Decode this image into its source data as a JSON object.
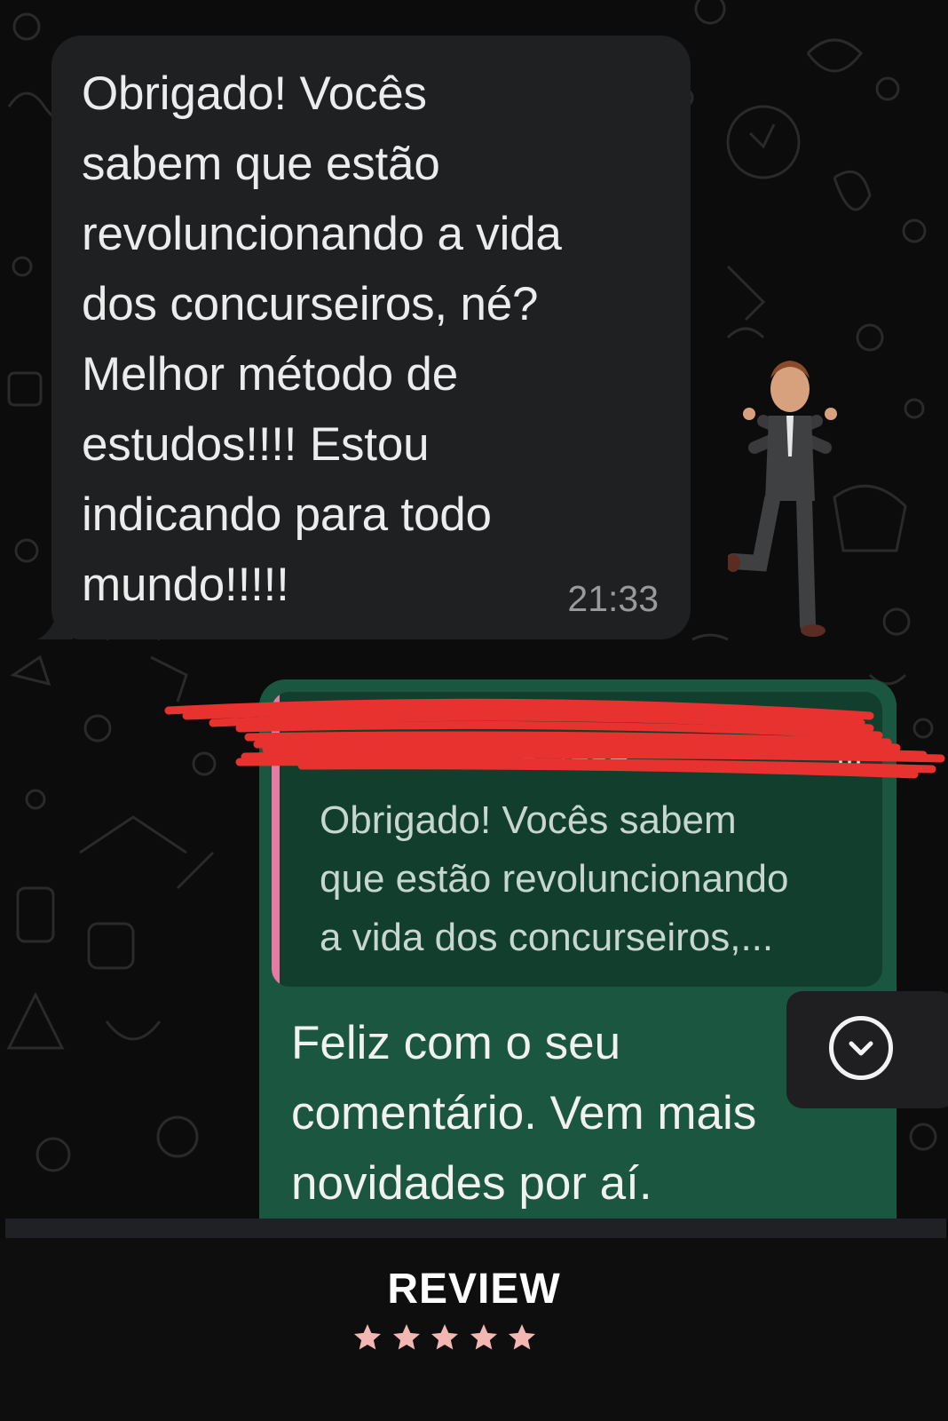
{
  "incoming_message": {
    "text": "Obrigado! Vocês\nsabem que estão\nrevoluncionando a vida\ndos concurseiros, né?\nMelhor método de\nestudos!!!! Estou\nindicando para todo\nmundo!!!!!",
    "time": "21:33"
  },
  "sticker": {
    "icon": "dancing-avatar-sticker-icon"
  },
  "outgoing_message": {
    "quote": {
      "text": "Obrigado! Vocês sabem\nque estão revoluncionando\na vida dos concurseiros,...",
      "more": "...",
      "bar_color": "#e57aa4"
    },
    "text": "Feliz com o seu\ncomentário. Vem mais\nnovidades por aí."
  },
  "scroll_button": {
    "icon": "chevron-down-icon"
  },
  "footer": {
    "title": "REVIEW",
    "rating": 5,
    "star_color": "#f2b7b3"
  },
  "colors": {
    "chat_background": "#0c0c0c",
    "incoming_bubble": "#1f2022",
    "outgoing_bubble": "#1b5740",
    "quote_background": "#123f2d",
    "redaction_scribble": "#e8322f"
  }
}
